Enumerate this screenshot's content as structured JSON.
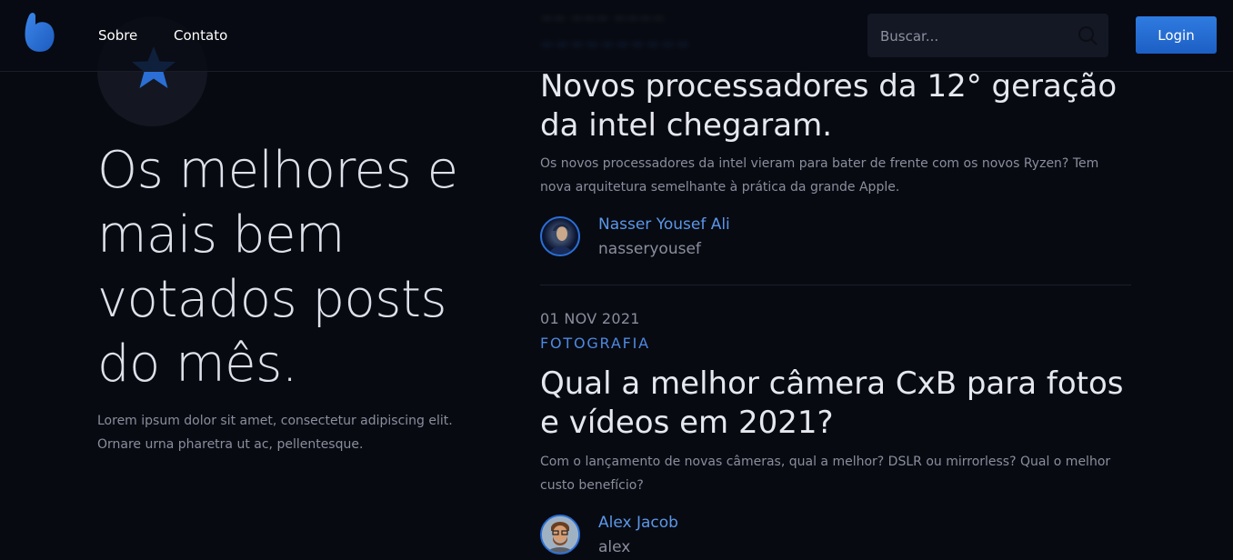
{
  "nav": {
    "logo": "logo-icon",
    "links": [
      "Sobre",
      "Contato"
    ],
    "search_placeholder": "Buscar...",
    "login_label": "Login",
    "accent_color": "#2b6fd6"
  },
  "hero": {
    "icon": "star-icon",
    "title": "Os melhores e mais bem votados posts do mês.",
    "subtitle": "Lorem ipsum dolor sit amet, consectetur adipiscing elit. Ornare urna pharetra ut ac, pellentesque."
  },
  "posts": [
    {
      "title": "Novos processadores da 12° geração da intel chegaram.",
      "excerpt": "Os novos processadores da intel vieram para bater de frente com os novos Ryzen? Tem nova arquitetura semelhante à prática da grande Apple.",
      "author_name": "Nasser Yousef Ali",
      "author_username": "nasseryousef"
    },
    {
      "date": "01 NOV 2021",
      "category": "FOTOGRAFIA",
      "title": "Qual a melhor câmera CxB para fotos e vídeos em 2021?",
      "excerpt": "Com o lançamento de novas câmeras, qual a melhor? DSLR ou mirrorless? Qual o melhor custo benefício?",
      "author_name": "Alex Jacob",
      "author_username": "alex"
    }
  ]
}
